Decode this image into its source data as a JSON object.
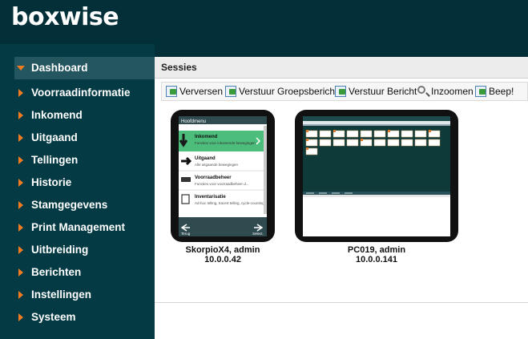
{
  "app": {
    "logo_text": "boxwise"
  },
  "colors": {
    "background": "#033038",
    "sidebar": "#033a44",
    "active_item": "#245660",
    "accent_orange": "#f07b22"
  },
  "sidebar": {
    "items": [
      {
        "label": "Dashboard",
        "active": true
      },
      {
        "label": "Voorraadinformatie"
      },
      {
        "label": "Inkomend"
      },
      {
        "label": "Uitgaand"
      },
      {
        "label": "Tellingen"
      },
      {
        "label": "Historie"
      },
      {
        "label": "Stamgegevens"
      },
      {
        "label": "Print Management"
      },
      {
        "label": "Uitbreiding"
      },
      {
        "label": "Berichten"
      },
      {
        "label": "Instellingen"
      },
      {
        "label": "Systeem"
      }
    ]
  },
  "panel": {
    "title": "Sessies"
  },
  "toolbar": {
    "refresh": "Verversen",
    "send_group": "Verstuur Groepsbericht",
    "send_message": "Verstuur Bericht",
    "zoom": "Inzoomen",
    "beep": "Beep!"
  },
  "sessions": [
    {
      "name": "SkorpioX4, admin",
      "ip": "10.0.0.42",
      "screen": {
        "header": "Hoofdmenu",
        "items": [
          {
            "title": "Inkomend",
            "desc": "Functies voor inkomende bewegingen"
          },
          {
            "title": "Uitgaand",
            "desc": "Alle uitgaande bewegingen"
          },
          {
            "title": "Voorraadbeheer",
            "desc": "Functies voor voorraadbeheer d..."
          },
          {
            "title": "Inventarisatie",
            "desc": "Ad-hoc telling, tracert telling, cycle-counting"
          }
        ],
        "footer_left": "Terug",
        "footer_right": "Select."
      }
    },
    {
      "name": "PC019, admin",
      "ip": "10.0.0.141"
    }
  ]
}
